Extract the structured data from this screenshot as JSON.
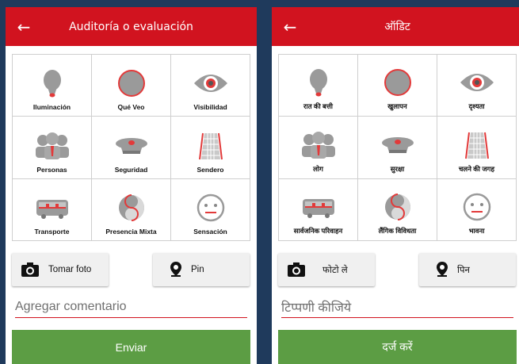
{
  "colors": {
    "appbar": "#d1131f",
    "accent_red": "#e23a3a",
    "submit": "#5c9d44",
    "background": "#1f3a5c"
  },
  "left": {
    "title": "Auditoría o evaluación",
    "categories": [
      {
        "label": "Iluminación",
        "icon": "lightbulb-icon"
      },
      {
        "label": "Qué Veo",
        "icon": "circle-icon"
      },
      {
        "label": "Visibilidad",
        "icon": "eye-icon"
      },
      {
        "label": "Personas",
        "icon": "people-icon"
      },
      {
        "label": "Seguridad",
        "icon": "police-cap-icon"
      },
      {
        "label": "Sendero",
        "icon": "path-icon"
      },
      {
        "label": "Transporte",
        "icon": "bus-icon"
      },
      {
        "label": "Presencia Mixta",
        "icon": "yin-yang-icon"
      },
      {
        "label": "Sensación",
        "icon": "face-icon"
      }
    ],
    "photo_label": "Tomar foto",
    "pin_label": "Pin",
    "comment_placeholder": "Agregar comentario",
    "submit_label": "Enviar"
  },
  "right": {
    "title": "ऑडिट",
    "categories": [
      {
        "label": "रात की बत्ती",
        "icon": "lightbulb-icon"
      },
      {
        "label": "खुलापन",
        "icon": "circle-icon"
      },
      {
        "label": "दृश्यता",
        "icon": "eye-icon"
      },
      {
        "label": "लोग",
        "icon": "people-icon"
      },
      {
        "label": "सुरक्षा",
        "icon": "police-cap-icon"
      },
      {
        "label": "चलने की जगह",
        "icon": "path-icon"
      },
      {
        "label": "सार्वजनिक परिवाहन",
        "icon": "bus-icon"
      },
      {
        "label": "लैंगिक विविधता",
        "icon": "yin-yang-icon"
      },
      {
        "label": "भावना",
        "icon": "face-icon"
      }
    ],
    "photo_label": "फोटो ले",
    "pin_label": "पिन",
    "comment_placeholder": "टिप्पणी कीजिये",
    "submit_label": "दर्ज करें"
  }
}
